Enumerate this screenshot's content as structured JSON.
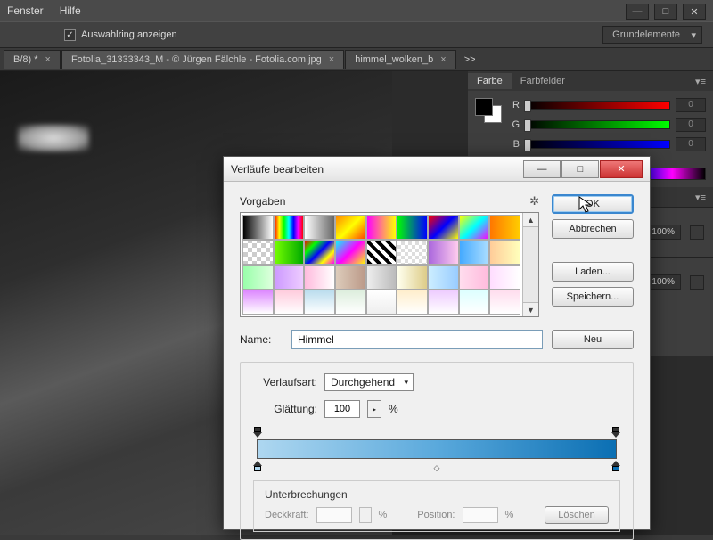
{
  "menu": {
    "items": [
      "Fenster",
      "Hilfe"
    ]
  },
  "optionbar": {
    "checkbox_label": "Auswahlring anzeigen",
    "checked": true,
    "workspace": "Grundelemente"
  },
  "tabs": {
    "t1": "B/8) *",
    "t2": "Fotolia_31333343_M - © Jürgen Fälchle - Fotolia.com.jpg",
    "t3": "himmel_wolken_b",
    "more": ">>"
  },
  "panel_color": {
    "tab1": "Farbe",
    "tab2": "Farbfelder",
    "r_label": "R",
    "g_label": "G",
    "b_label": "B",
    "r_val": "0",
    "g_val": "0",
    "b_val": "0"
  },
  "panel_generic": {
    "val": "100%"
  },
  "dialog": {
    "title": "Verläufe bearbeiten",
    "presets_label": "Vorgaben",
    "ok": "OK",
    "cancel": "Abbrechen",
    "load": "Laden...",
    "save": "Speichern...",
    "neu": "Neu",
    "name_label": "Name:",
    "name_value": "Himmel",
    "type_label": "Verlaufsart:",
    "type_value": "Durchgehend",
    "smooth_label": "Glättung:",
    "smooth_value": "100",
    "percent": "%",
    "stops_label": "Unterbrechungen",
    "opacity_label": "Deckkraft:",
    "position_label": "Position:",
    "delete": "Löschen"
  },
  "presets_gradients": [
    "linear-gradient(90deg,#000,#fff)",
    "linear-gradient(90deg,#f00,#ff0,#0f0,#0ff,#00f,#f0f,#f00)",
    "linear-gradient(90deg,#fff,#666)",
    "linear-gradient(135deg,#f80,#ff0,#f40)",
    "linear-gradient(90deg,#f0f,#ff0)",
    "linear-gradient(90deg,#0f0,#00f)",
    "linear-gradient(135deg,#f00,#00f,#ff0)",
    "linear-gradient(135deg,#ff0,#0ff,#f0f)",
    "linear-gradient(90deg,#f70,#fc0)",
    "repeating-conic-gradient(#ccc 0 25%,#fff 0 50%) 0/10px 10px",
    "linear-gradient(90deg,#7f0,#0a0)",
    "linear-gradient(135deg,#f00,#0f0,#00f,#ff0,#f0f)",
    "linear-gradient(135deg,#0ff,#f0f,#ff0)",
    "repeating-linear-gradient(45deg,#000 0 4px,#fff 4px 8px)",
    "repeating-conic-gradient(#ddd 0 25%,#fff 0 50%) 0/8px 8px",
    "linear-gradient(90deg,#a6d,#fce)",
    "linear-gradient(90deg,#4af,#adf)",
    "linear-gradient(90deg,#fc9,#ffb)",
    "linear-gradient(90deg,#9fa,#dfd)",
    "linear-gradient(90deg,#c9f,#ecf)",
    "linear-gradient(90deg,#fbd,#fff)",
    "linear-gradient(90deg,#dcb,#b98)",
    "linear-gradient(90deg,#eee,#bbb)",
    "linear-gradient(90deg,#ffe,#dc8)",
    "linear-gradient(90deg,#cef,#9cf)",
    "linear-gradient(90deg,#fde,#fbd)",
    "linear-gradient(90deg,#fdf,#fff)",
    "linear-gradient(#d8f,#fff)",
    "linear-gradient(#fcd,#fff)",
    "linear-gradient(#bde,#fff)",
    "linear-gradient(#ded,#fff)",
    "linear-gradient(#fff,#eee)",
    "linear-gradient(#fec,#fff)",
    "linear-gradient(#ecf,#fff)",
    "linear-gradient(#dff,#fff)",
    "linear-gradient(#fde,#fff)"
  ]
}
